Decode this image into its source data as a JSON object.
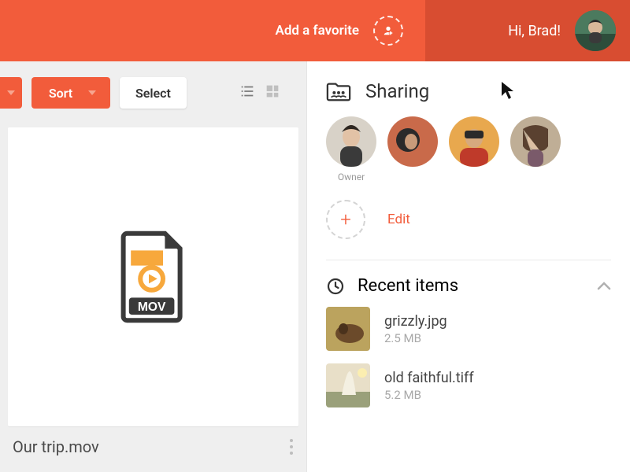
{
  "colors": {
    "primary": "#f25c3b",
    "primary_dark": "#d84d31"
  },
  "header": {
    "favorite_label": "Add a favorite",
    "greeting": "Hi, Brad!"
  },
  "toolbar": {
    "sort_label": "Sort",
    "select_label": "Select"
  },
  "file": {
    "name": "Our trip.mov",
    "badge": "MOV"
  },
  "sharing": {
    "title": "Sharing",
    "owner_label": "Owner",
    "edit_label": "Edit"
  },
  "recent": {
    "title": "Recent items",
    "items": [
      {
        "name": "grizzly.jpg",
        "size": "2.5 MB"
      },
      {
        "name": "old faithful.tiff",
        "size": "5.2 MB"
      }
    ]
  }
}
